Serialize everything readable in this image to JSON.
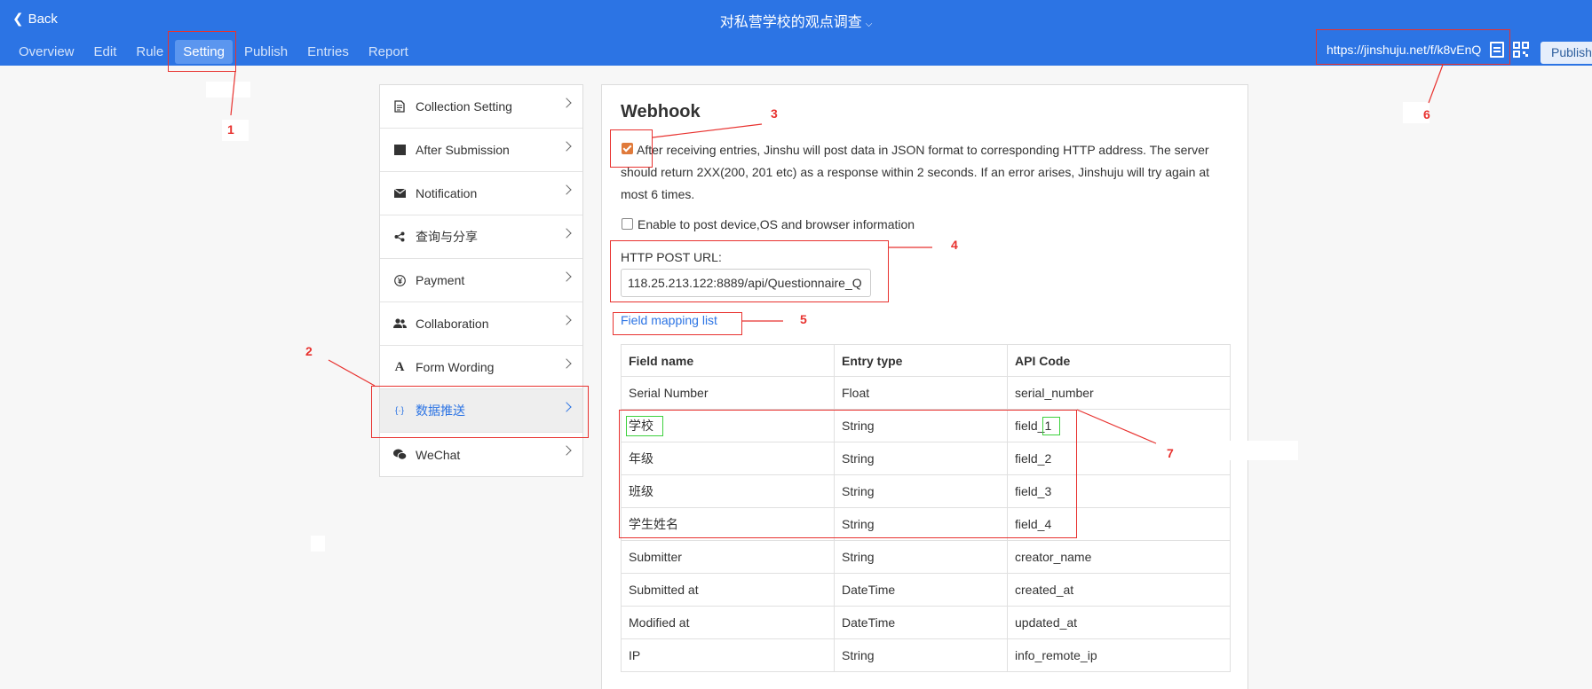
{
  "header": {
    "back_label": "Back",
    "title": "对私营学校的观点调查",
    "tabs": [
      "Overview",
      "Edit",
      "Rule",
      "Setting",
      "Publish",
      "Entries",
      "Report"
    ],
    "active_tab": "Setting",
    "share_url": "https://jinshuju.net/f/k8vEnQ",
    "publish_label": "Publish"
  },
  "sidebar": {
    "items": [
      {
        "label": "Collection Setting",
        "icon": "document-icon"
      },
      {
        "label": "After Submission",
        "icon": "square-icon"
      },
      {
        "label": "Notification",
        "icon": "envelope-icon"
      },
      {
        "label": "查询与分享",
        "icon": "share-icon"
      },
      {
        "label": "Payment",
        "icon": "yen-icon"
      },
      {
        "label": "Collaboration",
        "icon": "users-icon"
      },
      {
        "label": "Form Wording",
        "icon": "font-icon"
      },
      {
        "label": "数据推送",
        "icon": "code-braces-icon"
      },
      {
        "label": "WeChat",
        "icon": "wechat-icon"
      }
    ],
    "active_item": "数据推送"
  },
  "webhook": {
    "heading": "Webhook",
    "description": "After receiving entries, Jinshu will post data in JSON format to corresponding HTTP address. The server should return 2XX(200, 201 etc) as a response within 2 seconds. If an error arises, Jinshuju will try again at most 6 times.",
    "enable_checked": true,
    "device_info_label": "Enable to post device,OS and browser information",
    "device_info_checked": false,
    "post_url_label": "HTTP POST URL:",
    "post_url_value": "118.25.213.122:8889/api/Questionnaire_Q",
    "mapping_link": "Field mapping list"
  },
  "mapping_table": {
    "headers": [
      "Field name",
      "Entry type",
      "API Code"
    ],
    "rows": [
      [
        "Serial Number",
        "Float",
        "serial_number"
      ],
      [
        "学校",
        "String",
        "field_1"
      ],
      [
        "年级",
        "String",
        "field_2"
      ],
      [
        "班级",
        "String",
        "field_3"
      ],
      [
        "学生姓名",
        "String",
        "field_4"
      ],
      [
        "Submitter",
        "String",
        "creator_name"
      ],
      [
        "Submitted at",
        "DateTime",
        "created_at"
      ],
      [
        "Modified at",
        "DateTime",
        "updated_at"
      ],
      [
        "IP",
        "String",
        "info_remote_ip"
      ]
    ]
  },
  "annotations": [
    "1",
    "2",
    "3",
    "4",
    "5",
    "6",
    "7"
  ],
  "colors": {
    "header_bg": "#2c74e4",
    "accent": "#2c74e4",
    "annotation_red": "#e8322f",
    "annotation_green": "#3ed13e",
    "checkbox_orange": "#e07a3b"
  }
}
